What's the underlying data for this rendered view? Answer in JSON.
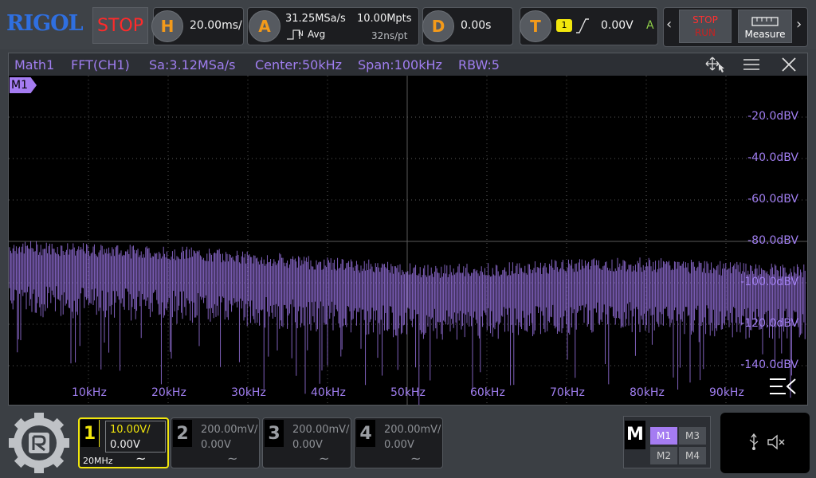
{
  "brand": {
    "logo": "RIGOL"
  },
  "run_state": {
    "label": "STOP"
  },
  "horizontal": {
    "badge": "H",
    "timebase": "20.00ms/"
  },
  "acquire": {
    "badge": "A",
    "sample_rate": "31.25MSa/s",
    "memory_depth": "10.00Mpts",
    "mode": "Avg",
    "mode_icon": "N",
    "time_per_point": "32ns/pt"
  },
  "delay": {
    "badge": "D",
    "value": "0.00s"
  },
  "trigger": {
    "badge": "T",
    "source": "1",
    "level": "0.00V",
    "sweep": "A"
  },
  "controls": {
    "run_stop_top": "STOP",
    "run_stop_bottom": "RUN",
    "measure_label": "Measure"
  },
  "math_panel": {
    "source": "Math1",
    "function": "FFT(CH1)",
    "sample_rate": "Sa:3.12MSa/s",
    "center": "Center:50kHz",
    "span": "Span:100kHz",
    "rbw": "RBW:5",
    "tag": "M1",
    "y_ticks": [
      "-20.0dBV",
      "-40.0dBV",
      "-60.0dBV",
      "-80.0dBV",
      "-100.0dBV",
      "-120.0dBV",
      "-140.0dBV"
    ],
    "x_ticks": [
      "10kHz",
      "20kHz",
      "30kHz",
      "40kHz",
      "50kHz",
      "60kHz",
      "70kHz",
      "80kHz",
      "90kHz"
    ]
  },
  "channels": [
    {
      "num": "1",
      "scale": "10.00V/",
      "offset": "0.00V",
      "bandwidth": "20MHz",
      "coupling": "~",
      "color": "#f2e70d",
      "active": true
    },
    {
      "num": "2",
      "scale": "200.00mV/",
      "offset": "0.00V",
      "coupling": "~",
      "active": false
    },
    {
      "num": "3",
      "scale": "200.00mV/",
      "offset": "0.00V",
      "coupling": "~",
      "active": false
    },
    {
      "num": "4",
      "scale": "200.00mV/",
      "offset": "0.00V",
      "coupling": "~",
      "active": false
    }
  ],
  "math_menu": {
    "label": "M",
    "items": [
      "M1",
      "M3",
      "M2",
      "M4"
    ],
    "active": "M1"
  },
  "colors": {
    "math_trace": "#a57cf2",
    "ch1": "#f2e70d",
    "stop": "#ff2a2a",
    "badge": "#f39a1a"
  }
}
